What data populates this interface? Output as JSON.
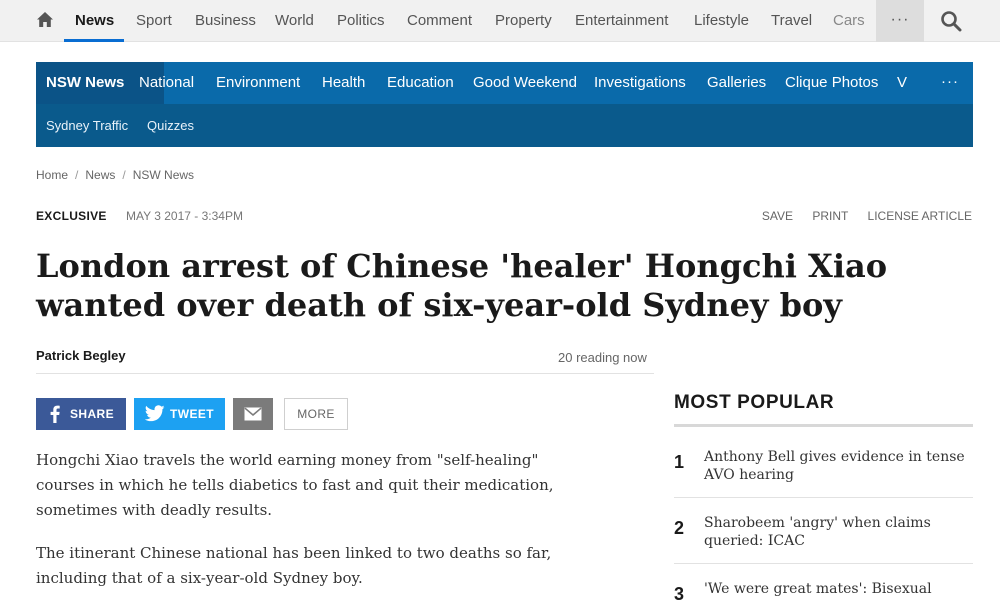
{
  "topnav": {
    "items": [
      "News",
      "Sport",
      "Business",
      "World",
      "Politics",
      "Comment",
      "Property",
      "Entertainment",
      "Lifestyle",
      "Travel",
      "Cars"
    ],
    "more_label": "···",
    "accent": "#096dd2"
  },
  "secnav": {
    "row1": [
      "NSW News",
      "National",
      "Environment",
      "Health",
      "Education",
      "Good Weekend",
      "Investigations",
      "Galleries",
      "Clique Photos",
      "V"
    ],
    "row2": [
      "Sydney Traffic",
      "Quizzes"
    ],
    "more_label": "···",
    "color": "#0a6aaa"
  },
  "breadcrumb": [
    "Home",
    "News",
    "NSW News"
  ],
  "article": {
    "tag": "EXCLUSIVE",
    "date": "MAY 3 2017 - 3:34PM",
    "tools": [
      "SAVE",
      "PRINT",
      "LICENSE ARTICLE"
    ],
    "headline": "London arrest of Chinese 'healer' Hongchi Xiao wanted over death of six-year-old Sydney boy",
    "byline": "Patrick Begley",
    "reading": "20 reading now",
    "share": {
      "facebook": "SHARE",
      "twitter": "TWEET",
      "more": "MORE"
    },
    "paragraphs": [
      "Hongchi Xiao travels the world earning money from \"self-healing\" courses in which he tells diabetics to fast and quit their medication, sometimes with deadly results.",
      "The itinerant Chinese national has been linked to two deaths so far, including that of a six-year-old Sydney boy."
    ]
  },
  "most_popular": {
    "title": "MOST POPULAR",
    "items": [
      {
        "num": "1",
        "text": "Anthony Bell gives evidence in tense AVO hearing"
      },
      {
        "num": "2",
        "text": "Sharobeem 'angry' when claims queried: ICAC"
      },
      {
        "num": "3",
        "text": "'We were great mates': Bisexual"
      }
    ]
  }
}
